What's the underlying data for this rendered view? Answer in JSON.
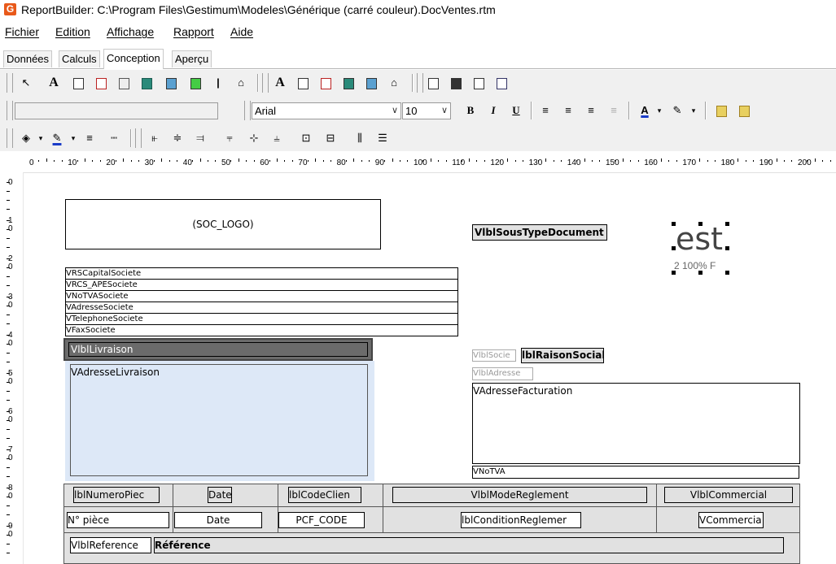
{
  "window": {
    "title": "ReportBuilder: C:\\Program Files\\Gestimum\\Modeles\\Générique (carré couleur).DocVentes.rtm",
    "icon_letter": "G"
  },
  "menu": [
    "Fichier",
    "Edition",
    "Affichage",
    "Rapport",
    "Aide"
  ],
  "tabs": [
    "Données",
    "Calculs",
    "Conception",
    "Aperçu"
  ],
  "active_tab": "Conception",
  "toolbar_format": {
    "style_combo": "",
    "font_name": "Arial",
    "font_size": "10",
    "bold": "B",
    "italic": "I",
    "underline": "U"
  },
  "ruler_marks": [
    "0",
    "10",
    "20",
    "30",
    "40",
    "50",
    "60",
    "70",
    "80",
    "90",
    "100",
    "110",
    "120",
    "130",
    "140",
    "150",
    "160",
    "170",
    "180",
    "190",
    "200"
  ],
  "vruler_marks": [
    "0",
    "1 0",
    "2 0",
    "3 0",
    "4 0",
    "5 0",
    "6 0",
    "7 0",
    "8 0",
    "9 0"
  ],
  "report": {
    "logo": "(SOC_LOGO)",
    "sous_type": "VlblSousTypeDocument",
    "image_text": "est",
    "image_sub": "2 100% F",
    "company_fields": [
      "VRSCapitalSociete",
      "VRCS_APESociete",
      "VNoTVASociete",
      "VAdresseSociete",
      "VTelephoneSociete",
      "VFaxSociete"
    ],
    "livraison_label": "VlblLivraison",
    "adresse_livraison": "VAdresseLivraison",
    "lbl_societe": "VlblSocie",
    "raison_sociale": "lblRaisonSociale",
    "lbl_adresse": "VlblAdresse",
    "adresse_facturation": "VAdresseFacturation",
    "notva": "VNoTVA",
    "header_row": [
      "lblNumeroPiec",
      "Date",
      "lblCodeClien",
      "VlblModeReglement",
      "VlblCommercial"
    ],
    "value_row": [
      "N° pièce",
      "Date",
      "PCF_CODE",
      "lblConditionReglemer",
      "VCommercia"
    ],
    "reference_label": "VlblReference",
    "reference_value": "Référence"
  }
}
